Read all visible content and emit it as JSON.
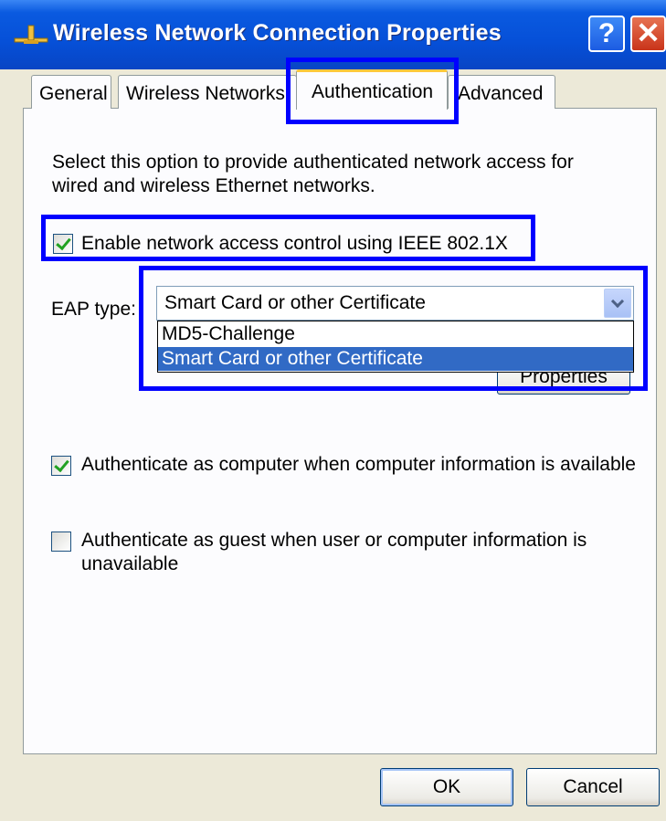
{
  "window": {
    "title": "Wireless Network Connection Properties",
    "app_icon": "network-connection-icon",
    "help_glyph": "?",
    "close_glyph": "✕"
  },
  "tabs": [
    {
      "label": "General",
      "active": false
    },
    {
      "label": "Wireless Networks",
      "active": false
    },
    {
      "label": "Authentication",
      "active": true
    },
    {
      "label": "Advanced",
      "active": false
    }
  ],
  "auth": {
    "description_line1": "Select this option to provide authenticated network access for",
    "description_line2": "wired and wireless Ethernet networks.",
    "enable_8021x": {
      "label": "Enable network access control using IEEE 802.1X",
      "checked": true
    },
    "eap_label": "EAP type:",
    "eap_selected": "Smart Card or other Certificate",
    "eap_options": [
      "MD5-Challenge",
      "Smart Card or other Certificate"
    ],
    "eap_highlighted_option": "Smart Card or other Certificate",
    "properties_button": "Properties",
    "auth_computer": {
      "label": "Authenticate as computer when computer information is available",
      "checked": true
    },
    "auth_guest": {
      "label_line1": "Authenticate as guest when user or computer information is",
      "label_line2": "unavailable",
      "checked": false
    }
  },
  "footer": {
    "ok": "OK",
    "cancel": "Cancel"
  },
  "colors": {
    "titlebar": "#0650d8",
    "highlight_box": "#0000ff",
    "selection": "#316ac5",
    "active_tab_accent": "#ffc83c"
  }
}
